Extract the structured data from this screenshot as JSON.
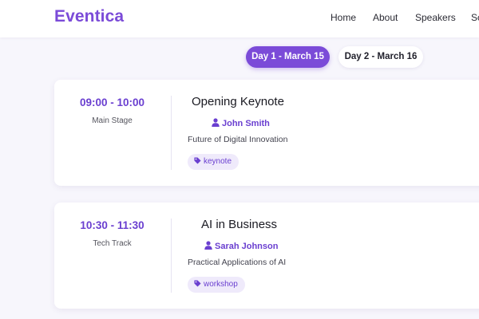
{
  "header": {
    "logo": "Eventica",
    "nav": [
      "Home",
      "About",
      "Speakers",
      "Sc"
    ]
  },
  "days": [
    {
      "label": "Day 1 - March 15",
      "active": true
    },
    {
      "label": "Day 2 - March 16",
      "active": false
    }
  ],
  "sessions": [
    {
      "time": "09:00 - 10:00",
      "room": "Main Stage",
      "title": "Opening Keynote",
      "speaker": "John Smith",
      "description": "Future of Digital Innovation",
      "tag": "keynote"
    },
    {
      "time": "10:30 - 11:30",
      "room": "Tech Track",
      "title": "AI in Business",
      "speaker": "Sarah Johnson",
      "description": "Practical Applications of AI",
      "tag": "workshop"
    }
  ],
  "colors": {
    "accent": "#7b4bd8",
    "background": "#f7f6fc"
  },
  "icons": {
    "speaker": "user-icon",
    "tag": "tag-icon"
  }
}
